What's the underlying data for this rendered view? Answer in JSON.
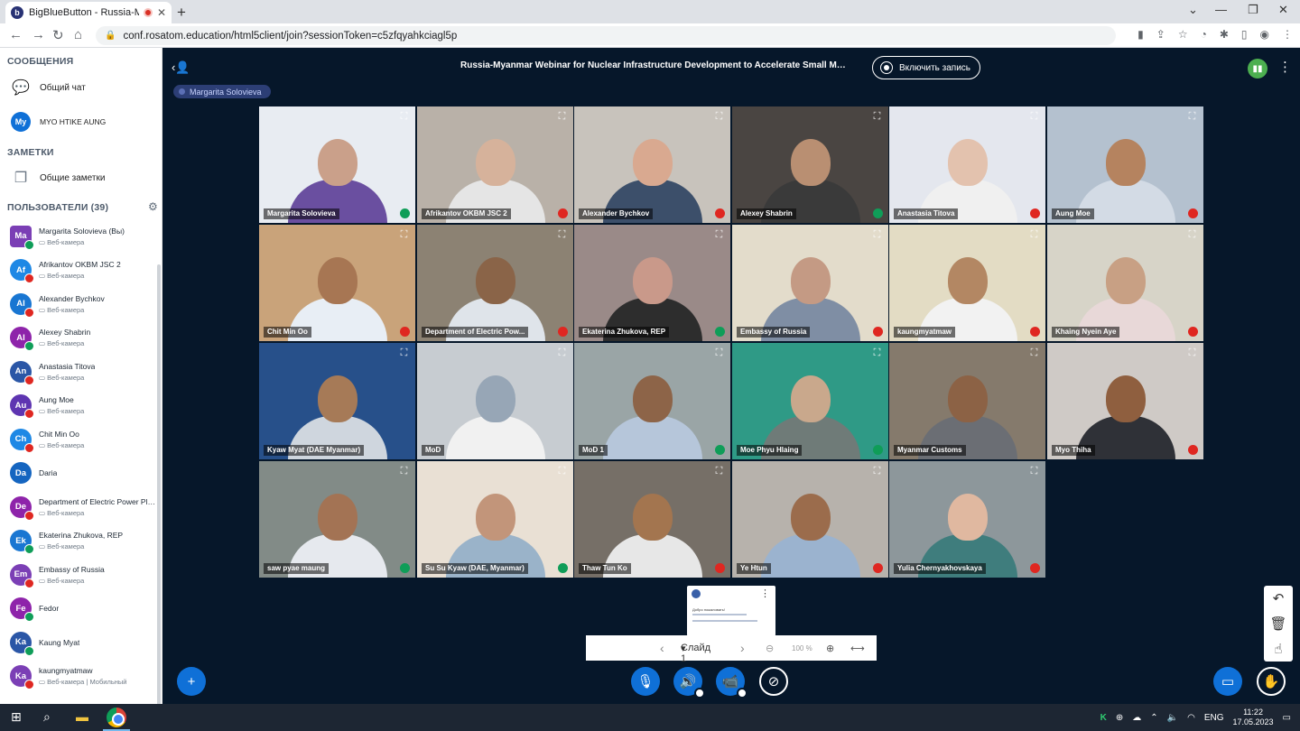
{
  "browser": {
    "tab_title": "BigBlueButton - Russia-Myan",
    "tab_favicon_letter": "b",
    "url": "conf.rosatom.education/html5client/join?sessionToken=c5zfqyahkciagl5p"
  },
  "sidebar": {
    "messages_title": "СООБЩЕНИЯ",
    "public_chat": "Общий чат",
    "private_chat_initials": "My",
    "private_chat_name": "MYO HTIKE AUNG",
    "notes_title": "ЗАМЕТКИ",
    "shared_notes": "Общие заметки",
    "users_title": "ПОЛЬЗОВАТЕЛИ (39)"
  },
  "users": [
    {
      "initials": "Ma",
      "name": "Margarita Solovieva (Вы)",
      "sub": "Веб-камера",
      "color": "#7b3fb5",
      "status": "listen",
      "self": true
    },
    {
      "initials": "Af",
      "name": "Afrikantov OKBM JSC 2",
      "sub": "Веб-камера",
      "color": "#1e88e5",
      "status": "muted"
    },
    {
      "initials": "Al",
      "name": "Alexander Bychkov",
      "sub": "Веб-камера",
      "color": "#1976d2",
      "status": "muted"
    },
    {
      "initials": "Al",
      "name": "Alexey Shabrin",
      "sub": "Веб-камера",
      "color": "#8e24aa",
      "status": "listen"
    },
    {
      "initials": "An",
      "name": "Anastasia Titova",
      "sub": "Веб-камера",
      "color": "#2a56a6",
      "status": "muted"
    },
    {
      "initials": "Au",
      "name": "Aung Moe",
      "sub": "Веб-камера",
      "color": "#5e35b1",
      "status": "muted"
    },
    {
      "initials": "Ch",
      "name": "Chit Min Oo",
      "sub": "Веб-камера",
      "color": "#1e88e5",
      "status": "muted"
    },
    {
      "initials": "Da",
      "name": "Daria",
      "sub": "",
      "color": "#1565c0",
      "status": ""
    },
    {
      "initials": "De",
      "name": "Department of Electric Power Plan...",
      "sub": "Веб-камера",
      "color": "#8e24aa",
      "status": "muted"
    },
    {
      "initials": "Ek",
      "name": "Ekaterina Zhukova, REP",
      "sub": "Веб-камера",
      "color": "#1976d2",
      "status": "listen"
    },
    {
      "initials": "Em",
      "name": "Embassy of Russia",
      "sub": "Веб-камера",
      "color": "#7b3fb5",
      "status": "muted"
    },
    {
      "initials": "Fe",
      "name": "Fedor",
      "sub": "",
      "color": "#8e24aa",
      "status": "listen"
    },
    {
      "initials": "Ka",
      "name": "Kaung Myat",
      "sub": "",
      "color": "#2a56a6",
      "status": "listen"
    },
    {
      "initials": "Ka",
      "name": "kaungmyatmaw",
      "sub": "Веб-камера | Мобильный",
      "color": "#7b3fb5",
      "status": "muted"
    }
  ],
  "meeting": {
    "title": "Russia-Myanmar Webinar for Nuclear Infrastructure Development to Accelerate Small Modular R...",
    "record_label": "Включить запись",
    "talking_indicator": "Margarita Solovieva"
  },
  "tiles": [
    {
      "name": "Margarita Solovieva",
      "bg": "#e8ecf2",
      "face": "#caa08a",
      "shirt": "#6a4fa0",
      "status": "listen"
    },
    {
      "name": "Afrikantov OKBM JSC 2",
      "bg": "#b9b1a8",
      "face": "#d6b29b",
      "shirt": "#e5e5e5",
      "status": "muted"
    },
    {
      "name": "Alexander Bychkov",
      "bg": "#c8c3bc",
      "face": "#d9a990",
      "shirt": "#3c4f6a",
      "status": "muted"
    },
    {
      "name": "Alexey Shabrin",
      "bg": "#4a4542",
      "face": "#b98f72",
      "shirt": "#3a3a3a",
      "status": "listen"
    },
    {
      "name": "Anastasia Titova",
      "bg": "#e4e7ee",
      "face": "#e3c2ae",
      "shirt": "#f0f0f0",
      "status": "muted"
    },
    {
      "name": "Aung Moe",
      "bg": "#b4c1cf",
      "face": "#b5835f",
      "shirt": "#d3dbe5",
      "status": "muted"
    },
    {
      "name": "Chit Min Oo",
      "bg": "#c9a37a",
      "face": "#a77653",
      "shirt": "#e8eef5",
      "status": "muted"
    },
    {
      "name": "Department of Electric Pow...",
      "bg": "#8c8273",
      "face": "#8a6448",
      "shirt": "#dfe4ea",
      "status": "muted"
    },
    {
      "name": "Ekaterina Zhukova, REP",
      "bg": "#9a8a88",
      "face": "#c9998a",
      "shirt": "#2d2d2d",
      "status": "listen"
    },
    {
      "name": "Embassy of Russia",
      "bg": "#e3dccb",
      "face": "#c49a84",
      "shirt": "#7f8ea4",
      "status": "muted"
    },
    {
      "name": "kaungmyatmaw",
      "bg": "#e3dcc4",
      "face": "#b38763",
      "shirt": "#f2f2f2",
      "status": "muted"
    },
    {
      "name": "Khaing Nyein Aye",
      "bg": "#d7d4c8",
      "face": "#c8a084",
      "shirt": "#e8d8d8",
      "status": "muted"
    },
    {
      "name": "Kyaw Myat (DAE Myanmar)",
      "bg": "#27508a",
      "face": "#a67a57",
      "shirt": "#cfd6de",
      "status": ""
    },
    {
      "name": "MoD",
      "bg": "#c7ccd1",
      "face": "#97a6b6",
      "shirt": "#f1f1f1",
      "status": ""
    },
    {
      "name": "MoD 1",
      "bg": "#9aa5a6",
      "face": "#8d6448",
      "shirt": "#b6c6da",
      "status": "listen"
    },
    {
      "name": "Moe Phyu Hlaing",
      "bg": "#2f9a86",
      "face": "#c9a88c",
      "shirt": "#6f7b78",
      "status": "listen"
    },
    {
      "name": "Myanmar Customs",
      "bg": "#857a6c",
      "face": "#8c6245",
      "shirt": "#6b6e74",
      "status": ""
    },
    {
      "name": "Myo Thiha",
      "bg": "#cfcac6",
      "face": "#8f5f3f",
      "shirt": "#2f3137",
      "status": "muted"
    },
    {
      "name": "saw pyae maung",
      "bg": "#828b87",
      "face": "#a37354",
      "shirt": "#e6e9ee",
      "status": "listen"
    },
    {
      "name": "Su Su Kyaw (DAE, Myanmar)",
      "bg": "#e9e0d4",
      "face": "#c2957a",
      "shirt": "#9ab3c9",
      "status": "listen"
    },
    {
      "name": "Thaw Tun Ko",
      "bg": "#766f67",
      "face": "#a3754f",
      "shirt": "#e7e7e7",
      "status": "muted"
    },
    {
      "name": "Ye Htun",
      "bg": "#b7b2ac",
      "face": "#9b6c4c",
      "shirt": "#9bb3cf",
      "status": "muted"
    },
    {
      "name": "Yulia Chernyakhovskaya",
      "bg": "#8d979b",
      "face": "#e0b8a0",
      "shirt": "#3f7d7d",
      "status": "muted"
    }
  ],
  "presentation": {
    "slide_label": "Слайд 1",
    "zoom_label": "100 %",
    "thumb_text": "Добро пожаловать!"
  },
  "taskbar": {
    "lang": "ENG",
    "time": "11:22",
    "date": "17.05.2023"
  }
}
